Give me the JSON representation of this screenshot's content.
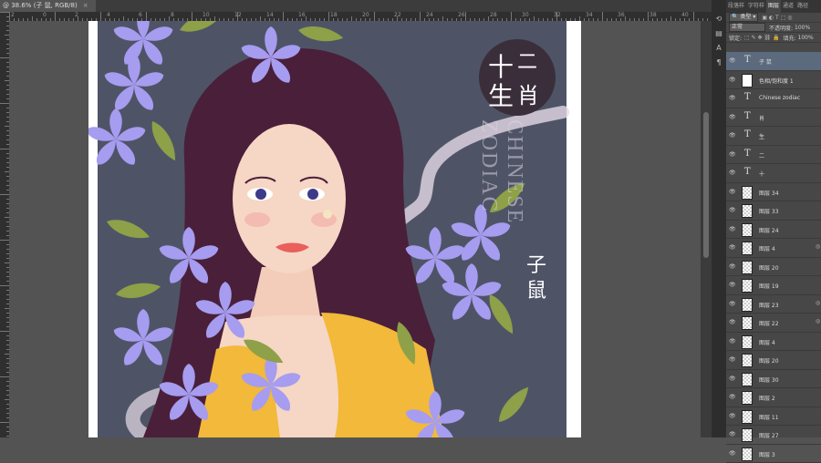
{
  "document_tab": {
    "title": "@ 38.6% (子 鼠, RGB/8)",
    "close": "×"
  },
  "ruler_top_labels": [
    "2",
    "0",
    "2",
    "4",
    "6",
    "8",
    "10",
    "12",
    "14",
    "16",
    "18",
    "20",
    "22",
    "24",
    "26",
    "28",
    "30",
    "32",
    "34",
    "36",
    "38",
    "40"
  ],
  "artwork": {
    "title_line1_a": "十",
    "title_line1_b": "二",
    "title_line2_a": "生",
    "title_line2_b": "肖",
    "vertical_text_1": "CHINESE",
    "vertical_text_2": "ZODIAC",
    "zodiac_char_1": "子",
    "zodiac_char_2": "鼠",
    "colors": {
      "background": "#4e5466",
      "hair": "#4a1f3a",
      "dress": "#f2b93a",
      "flower": "#a69cf0",
      "leaf": "#8ea048",
      "skin": "#f6d6c4"
    }
  },
  "panel": {
    "tabs": [
      "段落样",
      "字符样",
      "图层",
      "通道",
      "路径"
    ],
    "active_tab": "图层",
    "filter_kind": "类型",
    "blend_mode": "正常",
    "opacity_label": "不透明度:",
    "opacity_value": "100%",
    "lock_label": "锁定:",
    "fill_label": "填充:",
    "fill_value": "100%"
  },
  "layers": [
    {
      "kind": "text",
      "name": "子 鼠",
      "selected": true
    },
    {
      "kind": "adjust",
      "name": "色相/饱和度 1"
    },
    {
      "kind": "text",
      "name": "Chinese  zodiac"
    },
    {
      "kind": "text",
      "name": "肖"
    },
    {
      "kind": "text",
      "name": "生"
    },
    {
      "kind": "text",
      "name": "二"
    },
    {
      "kind": "text",
      "name": "十"
    },
    {
      "kind": "pixel",
      "name": "图层 34"
    },
    {
      "kind": "pixel",
      "name": "图层 33"
    },
    {
      "kind": "pixel",
      "name": "图层 24"
    },
    {
      "kind": "pixel",
      "name": "图层 4",
      "fx": true
    },
    {
      "kind": "pixel",
      "name": "图层 20"
    },
    {
      "kind": "pixel",
      "name": "图层 19"
    },
    {
      "kind": "pixel",
      "name": "图层 23",
      "fx": true
    },
    {
      "kind": "pixel",
      "name": "图层 22",
      "fx": true
    },
    {
      "kind": "pixel",
      "name": "图层 4"
    },
    {
      "kind": "pixel",
      "name": "图层 20"
    },
    {
      "kind": "pixel",
      "name": "图层 30"
    },
    {
      "kind": "pixel",
      "name": "图层 2"
    },
    {
      "kind": "pixel",
      "name": "图层 11"
    },
    {
      "kind": "pixel",
      "name": "图层 27"
    },
    {
      "kind": "pixel",
      "name": "图层 3"
    }
  ]
}
